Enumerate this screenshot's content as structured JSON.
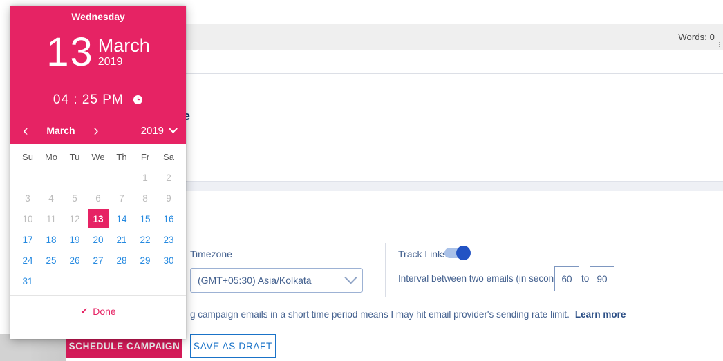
{
  "editor": {
    "words_label": "Words: 0"
  },
  "panel": {
    "heading_visible_fragment": "e"
  },
  "schedule": {
    "timezone_label": "Timezone",
    "timezone_value": "(GMT+05:30) Asia/Kolkata",
    "track_links_label": "Track Links",
    "track_links_on": true,
    "interval_label": "Interval between two emails (in seconds)",
    "interval_min": "60",
    "interval_to": "to",
    "interval_max": "90",
    "note_text": "g campaign emails in a short time period means I may hit email provider's sending rate limit.",
    "learn_more": "Learn more",
    "save_draft_label": "SAVE AS DRAFT",
    "schedule_label": "SCHEDULE CAMPAIGN"
  },
  "datepicker": {
    "weekday": "Wednesday",
    "day": "13",
    "month": "March",
    "year": "2019",
    "time": "04 : 25 PM",
    "nav": {
      "prev": "‹",
      "next": "›",
      "month": "March",
      "year": "2019"
    },
    "dow": [
      "Su",
      "Mo",
      "Tu",
      "We",
      "Th",
      "Fr",
      "Sa"
    ],
    "weeks": [
      [
        {
          "label": "",
          "state": "empty"
        },
        {
          "label": "",
          "state": "empty"
        },
        {
          "label": "",
          "state": "empty"
        },
        {
          "label": "",
          "state": "empty"
        },
        {
          "label": "",
          "state": "empty"
        },
        {
          "label": "1",
          "state": "disabled"
        },
        {
          "label": "2",
          "state": "disabled"
        }
      ],
      [
        {
          "label": "3",
          "state": "disabled"
        },
        {
          "label": "4",
          "state": "disabled"
        },
        {
          "label": "5",
          "state": "disabled"
        },
        {
          "label": "6",
          "state": "disabled"
        },
        {
          "label": "7",
          "state": "disabled"
        },
        {
          "label": "8",
          "state": "disabled"
        },
        {
          "label": "9",
          "state": "disabled"
        }
      ],
      [
        {
          "label": "10",
          "state": "disabled"
        },
        {
          "label": "11",
          "state": "disabled"
        },
        {
          "label": "12",
          "state": "disabled"
        },
        {
          "label": "13",
          "state": "selected"
        },
        {
          "label": "14",
          "state": "enabled"
        },
        {
          "label": "15",
          "state": "enabled"
        },
        {
          "label": "16",
          "state": "enabled"
        }
      ],
      [
        {
          "label": "17",
          "state": "enabled"
        },
        {
          "label": "18",
          "state": "enabled"
        },
        {
          "label": "19",
          "state": "enabled"
        },
        {
          "label": "20",
          "state": "enabled"
        },
        {
          "label": "21",
          "state": "enabled"
        },
        {
          "label": "22",
          "state": "enabled"
        },
        {
          "label": "23",
          "state": "enabled"
        }
      ],
      [
        {
          "label": "24",
          "state": "enabled"
        },
        {
          "label": "25",
          "state": "enabled"
        },
        {
          "label": "26",
          "state": "enabled"
        },
        {
          "label": "27",
          "state": "enabled"
        },
        {
          "label": "28",
          "state": "enabled"
        },
        {
          "label": "29",
          "state": "enabled"
        },
        {
          "label": "30",
          "state": "enabled"
        }
      ],
      [
        {
          "label": "31",
          "state": "enabled"
        },
        {
          "label": "",
          "state": "empty"
        },
        {
          "label": "",
          "state": "empty"
        },
        {
          "label": "",
          "state": "empty"
        },
        {
          "label": "",
          "state": "empty"
        },
        {
          "label": "",
          "state": "empty"
        },
        {
          "label": "",
          "state": "empty"
        }
      ]
    ],
    "done_label": "Done",
    "done_check": "✔"
  },
  "colors": {
    "accent_pink": "#e62364",
    "schedule_button": "#d31a58",
    "link_blue": "#2489e0",
    "text_blue": "#44618f",
    "toggle_on": "#2253c4",
    "toggle_track": "#a9c1e8"
  }
}
